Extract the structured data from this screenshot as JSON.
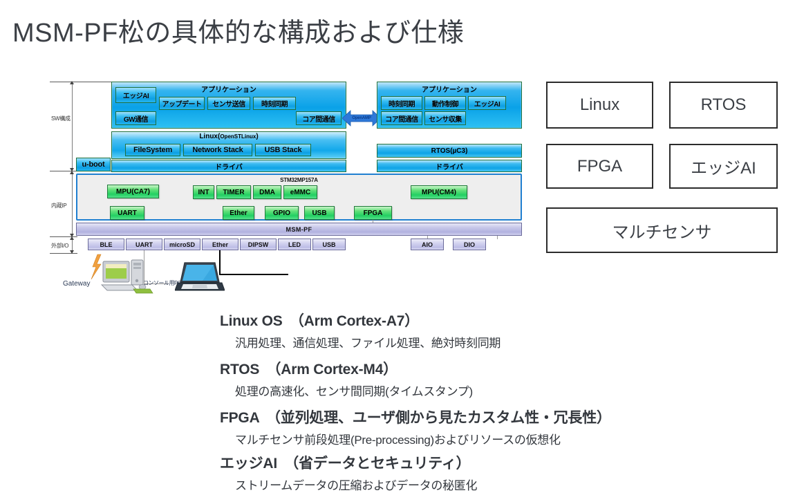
{
  "title": "MSM-PF松の具体的な構成および仕様",
  "diagram": {
    "axis_labels": {
      "sw": "SW構成",
      "ip": "内蔵IP",
      "io": "外部I/O"
    },
    "linux_side": {
      "app_panel_title": "アプリケーション",
      "app_blocks": [
        "エッジAI",
        "アップデート",
        "センサ送信",
        "時刻同期",
        "GW通信",
        "コア間通信"
      ],
      "os_title_main": "Linux(",
      "os_title_small": "OpenSTLinux",
      "os_title_end": ")",
      "os_blocks": [
        "FileSystem",
        "Network Stack",
        "USB Stack"
      ],
      "driver": "ドライバ",
      "uboot": "u-boot"
    },
    "bridge": {
      "label": "OpenAMP"
    },
    "rtos_side": {
      "app_panel_title": "アプリケーション",
      "app_blocks": [
        "時刻同期",
        "動作制御",
        "エッジAI",
        "コア間通信",
        "センサ収集"
      ],
      "os_title": "RTOS(µC3)",
      "driver": "ドライバ"
    },
    "hardware": {
      "chip_label": "STM32MP157A",
      "ip_blocks_row1": [
        "MPU(CA7)",
        "INT",
        "TIMER",
        "DMA",
        "eMMC",
        "MPU(CM4)"
      ],
      "ip_blocks_row2": [
        "UART",
        "Ether",
        "GPIO",
        "USB",
        "FPGA"
      ],
      "platform_bar": "MSM-PF",
      "io_blocks": [
        "BLE",
        "UART",
        "microSD",
        "Ether",
        "DIPSW",
        "LED",
        "USB"
      ],
      "io_blocks_right": [
        "AIO",
        "DIO"
      ]
    },
    "clipart": {
      "gateway_label": "Gateway",
      "console_pc_label": "コンソール用PC"
    }
  },
  "feature_boxes": [
    {
      "label": "Linux"
    },
    {
      "label": "RTOS"
    },
    {
      "label": "FPGA"
    },
    {
      "label": "エッジAI"
    },
    {
      "label": "マルチセンサ"
    }
  ],
  "specs": [
    {
      "head": "Linux OS　（Arm Cortex-A7）",
      "sub": "汎用処理、通信処理、ファイル処理、絶対時刻同期"
    },
    {
      "head": "RTOS　（Arm Cortex-M4）",
      "sub": "処理の高速化、センサ間同期(タイムスタンプ)"
    },
    {
      "head": "FPGA　（並列処理、ユーザ側から見たカスタム性・冗長性）",
      "sub": "マルチセンサ前段処理(Pre-processing)およびリソースの仮想化"
    },
    {
      "head": "エッジAI　（省データとセキュリティ）",
      "sub": "ストリームデータの圧縮およびデータの秘匿化"
    }
  ],
  "colors": {
    "title_text": "#3b3f45",
    "panel_blue": "#0aa2e8",
    "ip_green": "#22cf62",
    "platform_purple": "#b2b2e0",
    "chip_border": "#1f7fd0"
  }
}
